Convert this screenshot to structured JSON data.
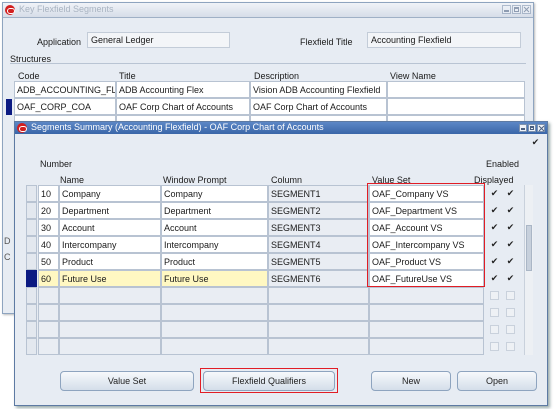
{
  "back_window": {
    "title": "Key Flexfield Segments",
    "application_label": "Application",
    "application_value": "General Ledger",
    "flexfield_title_label": "Flexfield Title",
    "flexfield_title_value": "Accounting Flexfield",
    "structures_label": "Structures",
    "columns": [
      "Code",
      "Title",
      "Description",
      "View Name"
    ],
    "rows": [
      [
        "ADB_ACCOUNTING_FL",
        "ADB Accounting Flex",
        "Vision ADB Accounting Flexfield",
        ""
      ],
      [
        "OAF_CORP_COA",
        "OAF Corp Chart of Accounts",
        "OAF Corp Chart of Accounts",
        ""
      ]
    ],
    "partial_letters": [
      "D",
      "C"
    ]
  },
  "front_window": {
    "title": "Segments Summary (Accounting Flexfield) - OAF Corp Chart of Accounts",
    "header_number": "Number",
    "header_enabled": "Enabled",
    "columns": {
      "name": "Name",
      "window_prompt": "Window Prompt",
      "column": "Column",
      "value_set": "Value Set",
      "displayed": "Displayed"
    },
    "rows": [
      {
        "number": "10",
        "name": "Company",
        "prompt": "Company",
        "column": "SEGMENT1",
        "value_set": "OAF_Company VS",
        "displayed": true,
        "enabled": true
      },
      {
        "number": "20",
        "name": "Department",
        "prompt": "Department",
        "column": "SEGMENT2",
        "value_set": "OAF_Department VS",
        "displayed": true,
        "enabled": true
      },
      {
        "number": "30",
        "name": "Account",
        "prompt": "Account",
        "column": "SEGMENT3",
        "value_set": "OAF_Account VS",
        "displayed": true,
        "enabled": true
      },
      {
        "number": "40",
        "name": "Intercompany",
        "prompt": "Intercompany",
        "column": "SEGMENT4",
        "value_set": "OAF_Intercompany VS",
        "displayed": true,
        "enabled": true
      },
      {
        "number": "50",
        "name": "Product",
        "prompt": "Product",
        "column": "SEGMENT5",
        "value_set": "OAF_Product VS",
        "displayed": true,
        "enabled": true
      },
      {
        "number": "60",
        "name": "Future Use",
        "prompt": "Future Use",
        "column": "SEGMENT6",
        "value_set": "OAF_FutureUse VS",
        "displayed": true,
        "enabled": true
      }
    ],
    "buttons": {
      "value_set": "Value Set",
      "flexfield_qualifiers": "Flexfield Qualifiers",
      "new": "New",
      "open": "Open"
    },
    "colors": {
      "highlight_box": "#e11d25",
      "active_row": "#fff8c2",
      "cursor": "#0b1a82"
    }
  }
}
